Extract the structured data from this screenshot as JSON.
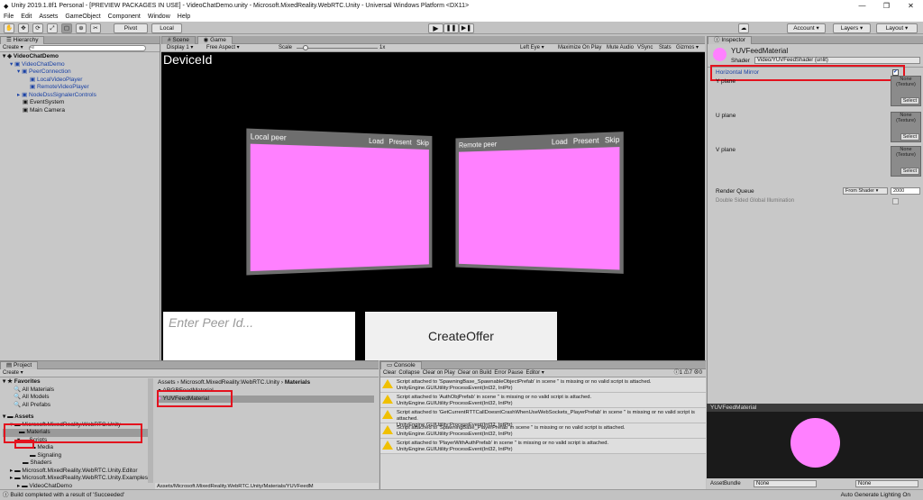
{
  "window": {
    "title": "Unity 2019.1.8f1 Personal - [PREVIEW PACKAGES IN USE] - VideoChatDemo.unity - Microsoft.MixedReality.WebRTC.Unity - Universal Windows Platform <DX11>"
  },
  "menu": [
    "File",
    "Edit",
    "Assets",
    "GameObject",
    "Component",
    "Window",
    "Help"
  ],
  "toolbar": {
    "pivot": "Pivot",
    "local": "Local",
    "account": "Account",
    "layers": "Layers",
    "layout": "Layout"
  },
  "hierarchy": {
    "tab": "Hierarchy",
    "create": "Create",
    "search_placeholder": "All",
    "scene": "VideoChatDemo",
    "items": [
      "VideoChatDemo",
      "PeerConnection",
      "LocalVideoPlayer",
      "RemoteVideoPlayer",
      "NodeDssSignalerControls",
      "EventSystem",
      "Main Camera"
    ]
  },
  "game": {
    "tabs": [
      "Scene",
      "Game"
    ],
    "display": "Display 1",
    "aspect": "Free Aspect",
    "scale_label": "Scale",
    "scale_value": "1x",
    "toggles": [
      "Left Eye",
      "Maximize On Play",
      "Mute Audio",
      "VSync",
      "Stats",
      "Gizmos"
    ],
    "device_id_label": "DeviceId",
    "local_panel": {
      "title": "Local peer",
      "buttons": [
        "Load",
        "Present",
        "Skip"
      ]
    },
    "remote_panel": {
      "title": "Remote peer",
      "buttons": [
        "Load",
        "Present",
        "Skip"
      ]
    },
    "peer_input_placeholder": "Enter Peer Id...",
    "create_offer": "CreateOffer"
  },
  "inspector": {
    "tab": "Inspector",
    "material_name": "YUVFeedMaterial",
    "shader_label": "Shader",
    "shader_value": "Video/YUVFeedShader (unlit)",
    "horizontal_mirror": "Horizontal Mirror",
    "planes": [
      "Y plane",
      "U plane",
      "V plane"
    ],
    "texture_none": "None",
    "texture_type": "(Texture)",
    "select": "Select",
    "render_queue_label": "Render Queue",
    "render_queue_mode": "From Shader",
    "render_queue_value": "2000",
    "double_sided": "Double Sided Global Illumination",
    "preview_title": "YUVFeedMaterial",
    "asset_bundle_label": "AssetBundle",
    "asset_bundle_value": "None",
    "asset_bundle_variant": "None"
  },
  "project": {
    "tab": "Project",
    "create": "Create",
    "favorites_label": "Favorites",
    "favorites": [
      "All Materials",
      "All Models",
      "All Prefabs"
    ],
    "assets_label": "Assets",
    "tree": [
      "Microsoft.MixedReality.WebRTC.Unity",
      "Materials",
      "Scripts",
      "Media",
      "Signaling",
      "Shaders",
      "Microsoft.MixedReality.WebRTC.Unity.Editor",
      "Microsoft.MixedReality.WebRTC.Unity.Examples",
      "VideoChatDemo"
    ],
    "breadcrumb": [
      "Assets",
      "Microsoft.MixedReality.WebRTC.Unity",
      "Materials"
    ],
    "files": [
      "ARGBFeedMaterial",
      "YUVFeedMaterial"
    ],
    "footer_path": "Assets/Microsoft.MixedReality.WebRTC.Unity/Materials/YUVFeedM"
  },
  "console": {
    "tab": "Console",
    "buttons": [
      "Clear",
      "Collapse",
      "Clear on Play",
      "Clear on Build",
      "Error Pause",
      "Editor"
    ],
    "counts": {
      "info": "1",
      "warn": "7",
      "error": "0"
    },
    "entries": [
      [
        "Script attached to 'SpawningBase_SpawnableObjectPrefab' in scene '' is missing or no valid script is attached.",
        "UnityEngine.GUIUtility:ProcessEvent(Int32, IntPtr)"
      ],
      [
        "Script attached to 'AuthObjPrefab' in scene '' is missing or no valid script is attached.",
        "UnityEngine.GUIUtility:ProcessEvent(Int32, IntPtr)"
      ],
      [
        "Script attached to 'GetCurrentRTTCallDoesntCrashWhenUseWebSockets_PlayerPrefab' in scene '' is missing or no valid script is attached.",
        "UnityEngine.GUIUtility:ProcessEvent(Int32, IntPtr)"
      ],
      [
        "Script attached to 'SpawningBase_PlayerPrefab' in scene '' is missing or no valid script is attached.",
        "UnityEngine.GUIUtility:ProcessEvent(Int32, IntPtr)"
      ],
      [
        "Script attached to 'PlayerWithAuthPrefab' in scene '' is missing or no valid script is attached.",
        "UnityEngine.GUIUtility:ProcessEvent(Int32, IntPtr)"
      ]
    ]
  },
  "status": {
    "message": "Build completed with a result of 'Succeeded'",
    "right": "Auto Generate Lighting On"
  },
  "colors": {
    "highlight": "#e3121e",
    "pink": "#ff80ff",
    "warning": "#f0c000"
  }
}
